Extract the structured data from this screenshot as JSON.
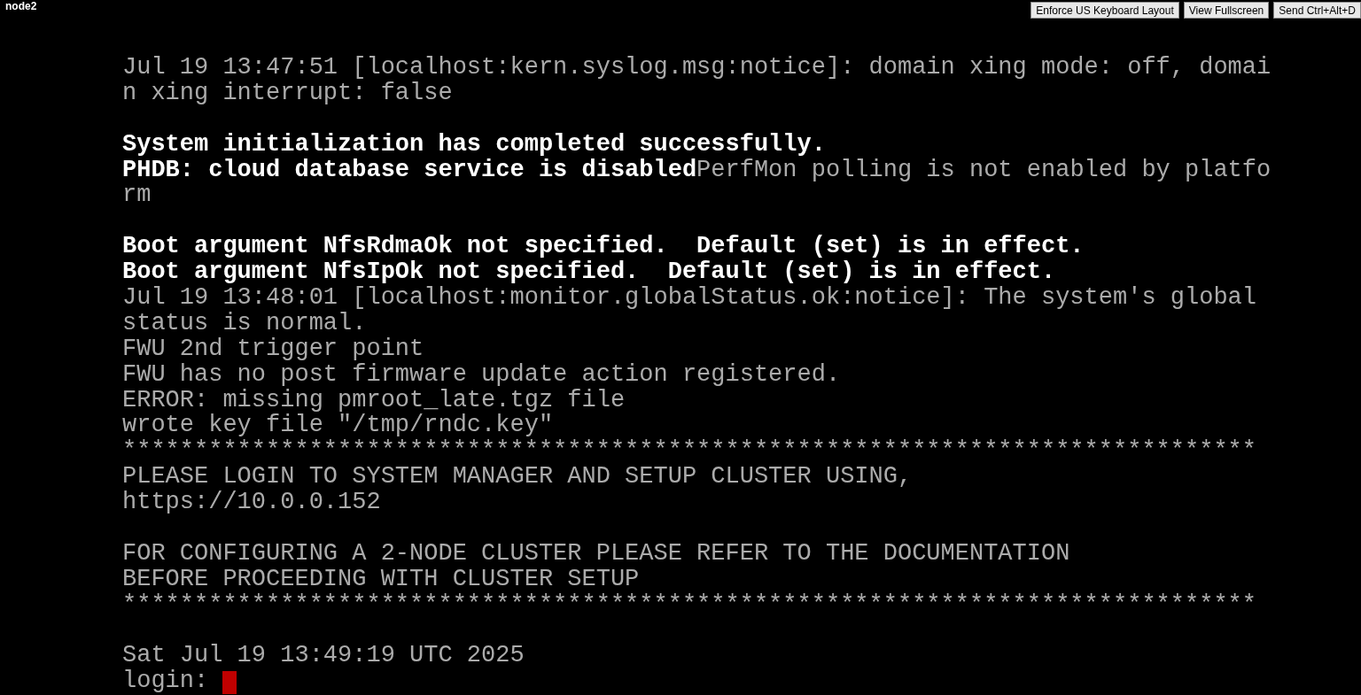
{
  "header": {
    "title": "node2",
    "buttons": [
      "Enforce US Keyboard Layout",
      "View Fullscreen",
      "Send Ctrl+Alt+D"
    ]
  },
  "console": {
    "lines": [
      {
        "kind": "text",
        "segments": [
          {
            "text": "Jul 19 13:47:51 [localhost:kern.syslog.msg:notice]: domain xing mode: off, domai",
            "bright": false
          }
        ]
      },
      {
        "kind": "text",
        "segments": [
          {
            "text": "n xing interrupt: false",
            "bright": false
          }
        ]
      },
      {
        "kind": "blank"
      },
      {
        "kind": "text",
        "segments": [
          {
            "text": "System initialization has completed successfully.",
            "bright": true
          }
        ]
      },
      {
        "kind": "text",
        "segments": [
          {
            "text": "PHDB: cloud database service is disabled",
            "bright": true
          },
          {
            "text": "PerfMon polling is not enabled by platfo",
            "bright": false
          }
        ]
      },
      {
        "kind": "text",
        "segments": [
          {
            "text": "rm",
            "bright": false
          }
        ]
      },
      {
        "kind": "blank"
      },
      {
        "kind": "text",
        "segments": [
          {
            "text": "Boot argument NfsRdmaOk not specified.  Default (set) is in effect.",
            "bright": true
          }
        ]
      },
      {
        "kind": "text",
        "segments": [
          {
            "text": "Boot argument NfsIpOk not specified.  Default (set) is in effect.",
            "bright": true
          }
        ]
      },
      {
        "kind": "text",
        "segments": [
          {
            "text": "Jul 19 13:48:01 [localhost:monitor.globalStatus.ok:notice]: The system's global",
            "bright": false
          }
        ]
      },
      {
        "kind": "text",
        "segments": [
          {
            "text": "status is normal.",
            "bright": false
          }
        ]
      },
      {
        "kind": "text",
        "segments": [
          {
            "text": "FWU 2nd trigger point",
            "bright": false
          }
        ]
      },
      {
        "kind": "text",
        "segments": [
          {
            "text": "FWU has no post firmware update action registered.",
            "bright": false
          }
        ]
      },
      {
        "kind": "text",
        "segments": [
          {
            "text": "ERROR: missing pmroot_late.tgz file",
            "bright": false
          }
        ]
      },
      {
        "kind": "text",
        "segments": [
          {
            "text": "wrote key file \"/tmp/rndc.key\"",
            "bright": false
          }
        ]
      },
      {
        "kind": "text",
        "segments": [
          {
            "text": "*******************************************************************************",
            "bright": false
          }
        ]
      },
      {
        "kind": "text",
        "segments": [
          {
            "text": "PLEASE LOGIN TO SYSTEM MANAGER AND SETUP CLUSTER USING,",
            "bright": false
          }
        ]
      },
      {
        "kind": "text",
        "segments": [
          {
            "text": "https://10.0.0.152",
            "bright": false
          }
        ]
      },
      {
        "kind": "blank"
      },
      {
        "kind": "text",
        "segments": [
          {
            "text": "FOR CONFIGURING A 2-NODE CLUSTER PLEASE REFER TO THE DOCUMENTATION",
            "bright": false
          }
        ]
      },
      {
        "kind": "text",
        "segments": [
          {
            "text": "BEFORE PROCEEDING WITH CLUSTER SETUP",
            "bright": false
          }
        ]
      },
      {
        "kind": "text",
        "segments": [
          {
            "text": "*******************************************************************************",
            "bright": false
          }
        ]
      },
      {
        "kind": "blank"
      },
      {
        "kind": "text",
        "segments": [
          {
            "text": "Sat Jul 19 13:49:19 UTC 2025",
            "bright": false
          }
        ]
      },
      {
        "kind": "prompt",
        "segments": [
          {
            "text": "login:",
            "bright": false
          }
        ]
      }
    ]
  }
}
